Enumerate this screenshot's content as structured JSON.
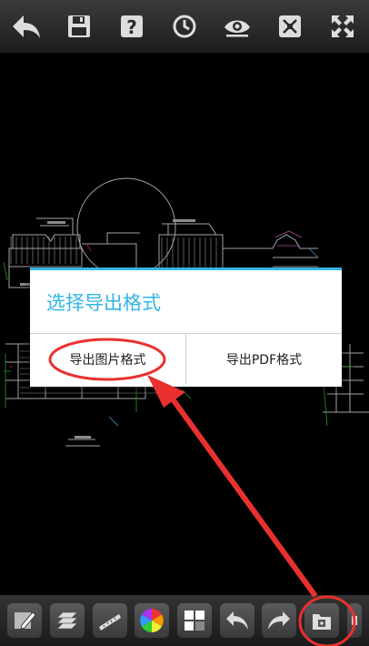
{
  "toolbar": {
    "icons": [
      "back-arrow-icon",
      "save-icon",
      "help-icon",
      "history-clock-icon",
      "view-eye-icon",
      "fit-screen-icon",
      "fullscreen-icon"
    ]
  },
  "dialog": {
    "title": "选择导出格式",
    "image_button": "导出图片格式",
    "pdf_button": "导出PDF格式",
    "accent_color": "#33b5e5"
  },
  "bottom_toolbar": {
    "icons": [
      "draw-pencil-icon",
      "layers-icon",
      "measure-ruler-icon",
      "color-wheel-icon",
      "layout-grid-icon",
      "undo-icon",
      "redo-icon",
      "export-folder-icon",
      "more-icon"
    ]
  },
  "annotation_color": "#e8312f"
}
